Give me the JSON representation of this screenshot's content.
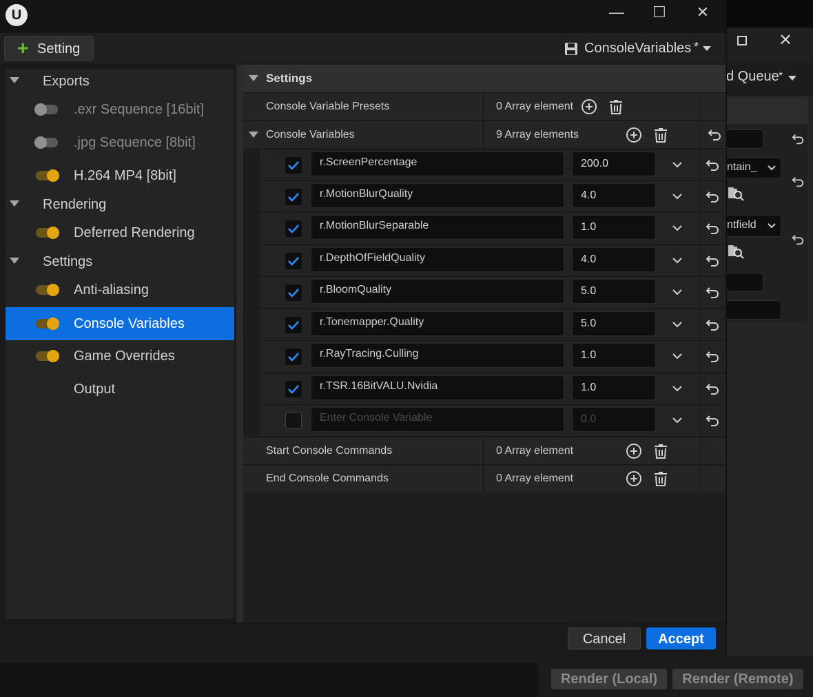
{
  "window": {
    "minimize": "—",
    "maximize": "☐",
    "close": "✕"
  },
  "toolbar": {
    "add_setting_label": "Setting",
    "preset_label": "ConsoleVariables",
    "preset_modified": "*"
  },
  "sidebar": {
    "rows": [
      {
        "kind": "category",
        "label": "Exports"
      },
      {
        "kind": "item",
        "label": ".exr Sequence [16bit]",
        "enabled": false
      },
      {
        "kind": "item",
        "label": ".jpg Sequence [8bit]",
        "enabled": false
      },
      {
        "kind": "item",
        "label": "H.264 MP4 [8bit]",
        "enabled": true
      },
      {
        "kind": "category",
        "label": "Rendering"
      },
      {
        "kind": "item",
        "label": "Deferred Rendering",
        "enabled": true
      },
      {
        "kind": "category",
        "label": "Settings"
      },
      {
        "kind": "item",
        "label": "Anti-aliasing",
        "enabled": true
      },
      {
        "kind": "item",
        "label": "Console Variables",
        "enabled": true,
        "selected": true
      },
      {
        "kind": "item",
        "label": "Game Overrides",
        "enabled": true
      },
      {
        "kind": "item",
        "label": "Output",
        "toggle": false
      }
    ]
  },
  "details": {
    "section_title": "Settings",
    "presets": {
      "name": "Console Variable Presets",
      "value": "0 Array element"
    },
    "console_variables": {
      "name": "Console Variables",
      "value": "9 Array elements",
      "rows": [
        {
          "name": "r.ScreenPercentage",
          "value": "200.0",
          "enabled": true
        },
        {
          "name": "r.MotionBlurQuality",
          "value": "4.0",
          "enabled": true
        },
        {
          "name": "r.MotionBlurSeparable",
          "value": "1.0",
          "enabled": true
        },
        {
          "name": "r.DepthOfFieldQuality",
          "value": "4.0",
          "enabled": true
        },
        {
          "name": "r.BloomQuality",
          "value": "5.0",
          "enabled": true
        },
        {
          "name": "r.Tonemapper.Quality",
          "value": "5.0",
          "enabled": true
        },
        {
          "name": "r.RayTracing.Culling",
          "value": "1.0",
          "enabled": true
        },
        {
          "name": "r.TSR.16BitVALU.Nvidia",
          "value": "1.0",
          "enabled": true
        },
        {
          "name": "",
          "placeholder": "Enter Console Variable",
          "value": "",
          "value_placeholder": "0.0",
          "enabled": false
        }
      ]
    },
    "start_commands": {
      "name": "Start Console Commands",
      "value": "0 Array element"
    },
    "end_commands": {
      "name": "End Console Commands",
      "value": "0 Array element"
    }
  },
  "footer": {
    "cancel_label": "Cancel",
    "accept_label": "Accept"
  },
  "background_window": {
    "queue_label": "d Queue",
    "queue_modified": "*",
    "fragment_1": "ntain_",
    "fragment_2": "ntfield",
    "render_local": "Render (Local)",
    "render_remote": "Render (Remote)"
  },
  "colors": {
    "accent": "#0d6ee0",
    "toggle_on": "#e3a510",
    "add_icon": "#6fbf3a"
  }
}
